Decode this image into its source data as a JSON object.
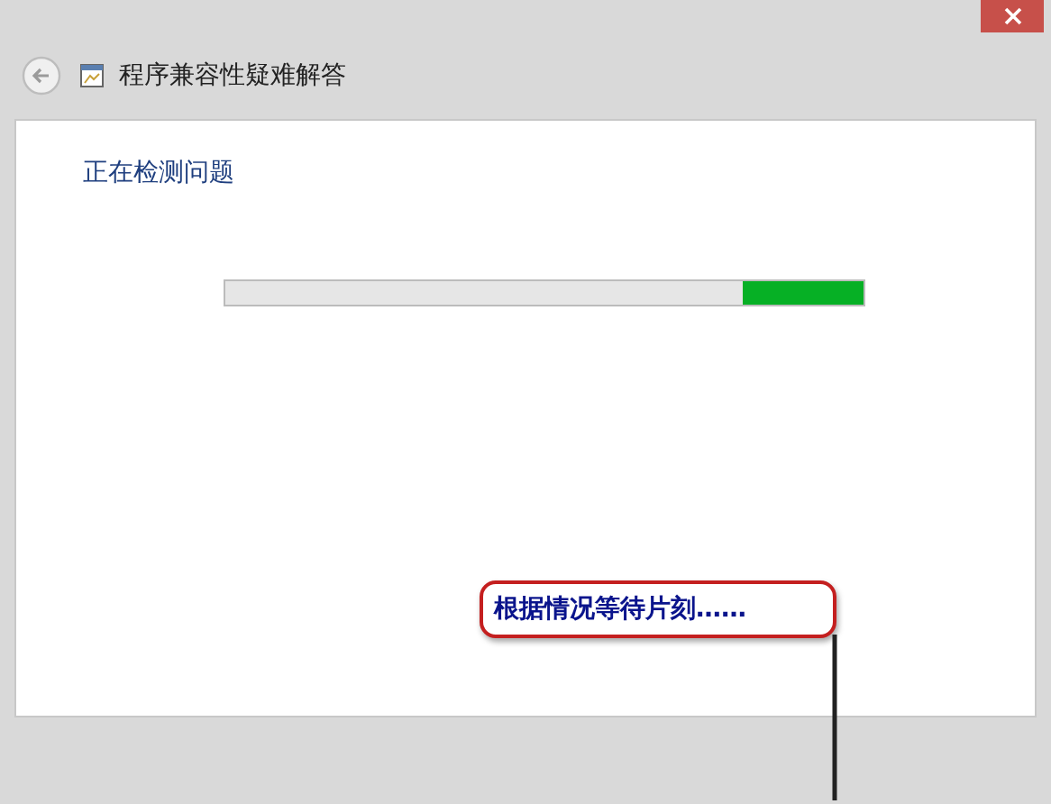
{
  "window": {
    "title": "程序兼容性疑难解答"
  },
  "content": {
    "heading": "正在检测问题",
    "progress": {
      "level": 0.19
    }
  },
  "callout": {
    "text": "根据情况等待片刻……"
  }
}
